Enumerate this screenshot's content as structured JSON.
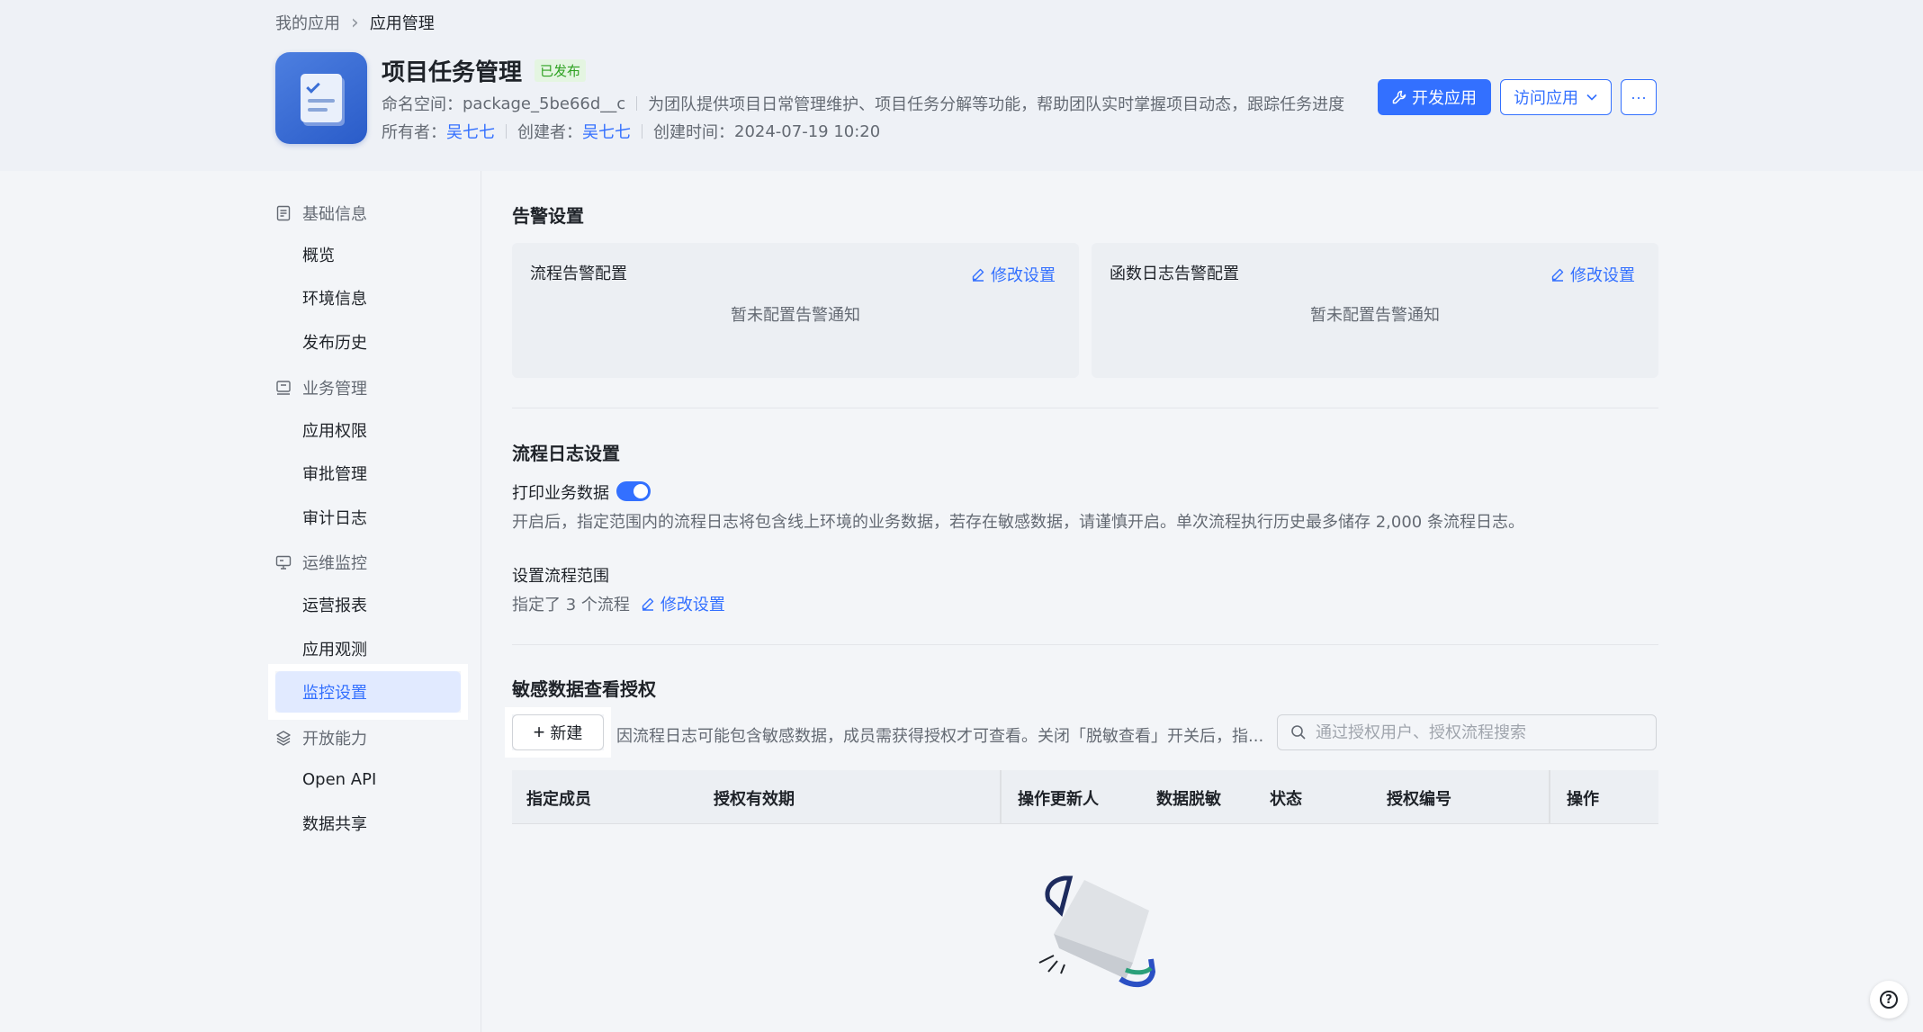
{
  "breadcrumb": {
    "parent": "我的应用",
    "current": "应用管理"
  },
  "app": {
    "name": "项目任务管理",
    "status": "已发布",
    "namespace_label": "命名空间：",
    "namespace": "package_5be66d__c",
    "description": "为团队提供项目日常管理维护、项目任务分解等功能，帮助团队实时掌握项目动态，跟踪任务进度",
    "owner_label": "所有者：",
    "owner": "吴七七",
    "creator_label": "创建者：",
    "creator": "吴七七",
    "created_label": "创建时间：",
    "created": "2024-07-19 10:20"
  },
  "header_buttons": {
    "develop": "开发应用",
    "visit": "访问应用",
    "more": "···"
  },
  "sidebar": {
    "groups": [
      {
        "label": "基础信息",
        "icon": "document-icon",
        "items": [
          "概览",
          "环境信息",
          "发布历史"
        ]
      },
      {
        "label": "业务管理",
        "icon": "briefcase-icon",
        "items": [
          "应用权限",
          "审批管理",
          "审计日志"
        ]
      },
      {
        "label": "运维监控",
        "icon": "monitor-icon",
        "items": [
          "运营报表",
          "应用观测",
          "监控设置"
        ]
      },
      {
        "label": "开放能力",
        "icon": "layers-icon",
        "items": [
          "Open API",
          "数据共享"
        ]
      }
    ],
    "active": "监控设置"
  },
  "alert": {
    "title": "告警设置",
    "flow_card": {
      "title": "流程告警配置",
      "edit": "修改设置",
      "empty": "暂未配置告警通知"
    },
    "func_card": {
      "title": "函数日志告警配置",
      "edit": "修改设置",
      "empty": "暂未配置告警通知"
    }
  },
  "flowlog": {
    "title": "流程日志设置",
    "print_label": "打印业务数据",
    "print_enabled": true,
    "desc": "开启后，指定范围内的流程日志将包含线上环境的业务数据，若存在敏感数据，请谨慎开启。单次流程执行历史最多储存 2,000 条流程日志。",
    "scope_title": "设置流程范围",
    "scope_value": "指定了 3 个流程",
    "scope_edit": "修改设置"
  },
  "sensitive": {
    "title": "敏感数据查看授权",
    "new_button": "新建",
    "hint": "因流程日志可能包含敏感数据，成员需获得授权才可查看。关闭「脱敏查看」开关后，指...",
    "search_placeholder": "通过授权用户、授权流程搜索",
    "columns": [
      "指定成员",
      "授权有效期",
      "操作更新人",
      "数据脱敏",
      "状态",
      "授权编号",
      "操作"
    ]
  },
  "colors": {
    "accent": "#3370ff",
    "success": "#2ea121"
  }
}
